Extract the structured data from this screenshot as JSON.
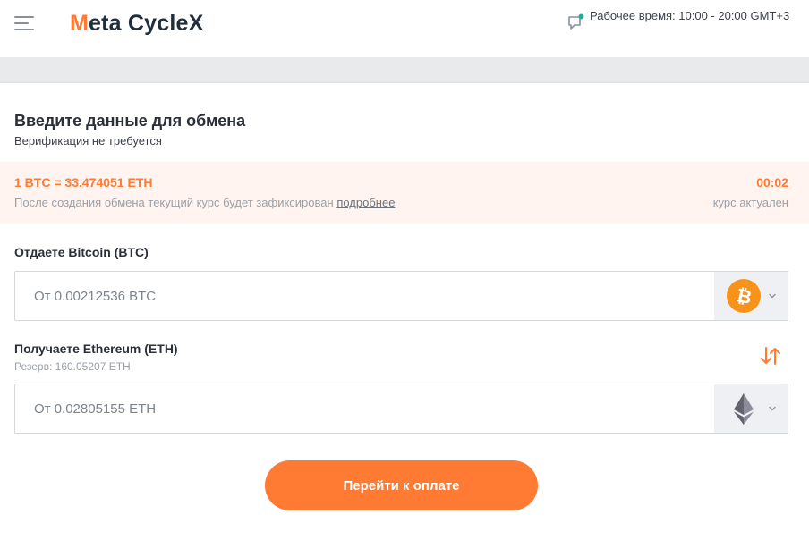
{
  "header": {
    "logo_first_letter": "M",
    "logo_rest": "eta CycleX",
    "hours_text": "Рабочее время: 10:00 - 20:00 GMT+3",
    "menu_icon": "hamburger-menu-icon",
    "chat_icon": "chat-bubble-icon"
  },
  "form": {
    "title": "Введите данные для обмена",
    "subtitle": "Верификация не требуется",
    "rate": {
      "main": "1 BTC = 33.474051 ETH",
      "note": "После создания обмена текущий курс будет зафиксирован",
      "link": "подробнее",
      "timer": "00:02",
      "status": "курс актуален"
    },
    "give": {
      "label": "Отдаете Bitcoin (BTC)",
      "placeholder": "От 0.00212536 BTC",
      "coin_icon": "bitcoin-icon"
    },
    "receive": {
      "label": "Получаете Ethereum (ETH)",
      "reserve": "Резерв: 160.05207 ETH",
      "placeholder": "От 0.02805155 ETH",
      "coin_icon": "ethereum-icon"
    },
    "swap_icon": "swap-arrows-icon",
    "submit_label": "Перейти к оплате"
  },
  "colors": {
    "accent": "#ff7a33",
    "rate_background": "#fff4ef",
    "online_dot": "#19b394",
    "bitcoin": "#f7931a"
  }
}
